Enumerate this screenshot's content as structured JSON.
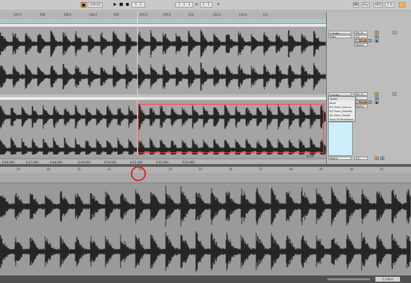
{
  "toolbar": {
    "tempo": "106.00",
    "signature": "1 . 1",
    "position": "1 . 1 . 1",
    "loop_length": "1 . 1",
    "key_label": "Key",
    "midi_label": "MIDI",
    "cpu": "1 %",
    "play_icon": "play-icon",
    "stop_icon": "stop-icon",
    "record_icon": "record-icon"
  },
  "arrangement": {
    "ruler_labels": [
      "207.4",
      "208",
      "208.2",
      "208.4",
      "209",
      "209.2",
      "209.4",
      "210",
      "210.2",
      "210.4",
      "211"
    ],
    "time_labels": [
      "6:46.000",
      "6:47.000",
      "6:48.000",
      "6:49.000",
      "6:50.000",
      "6:51.000",
      "6:52.000",
      "6:53.000"
    ],
    "page_indicator": "1/16"
  },
  "mixer": {
    "tracks": [
      {
        "name": "1 Audio",
        "device": "None",
        "routing_in": "Ext. In",
        "routing_ch": "1/2",
        "monitor_in": "In",
        "monitor_auto": "Auto",
        "monitor_off": "Off",
        "output": "Master",
        "number": "1"
      },
      {
        "name": "2 Audio",
        "device": "Sweep",
        "routing_in": "Ext. In",
        "routing_ch": "1",
        "monitor_in": "In",
        "monitor_auto": "Auto",
        "monitor_off": "Off",
        "output": "Master",
        "number": "2"
      }
    ],
    "popup": {
      "header": "None",
      "items": [
        "EQ Three | Gain Lo",
        "EQ Three | GainMid",
        "EQ Three | GainHi"
      ],
      "footer": "Show All Parameters"
    },
    "master": {
      "name": "Master",
      "routing": "1/2",
      "number": "0"
    }
  },
  "detail": {
    "ruler_labels": [
      "29",
      "30",
      "31",
      "32",
      "33",
      "34",
      "35",
      "36",
      "37",
      "38",
      "39",
      "40",
      "41"
    ],
    "status": "1.2 Bars"
  },
  "colors": {
    "accent_orange": "#ffb04a",
    "accent_blue": "#67c6ea",
    "selection_red": "#ff4444",
    "circle_red": "#e01f1f",
    "waveform": "#262626"
  }
}
